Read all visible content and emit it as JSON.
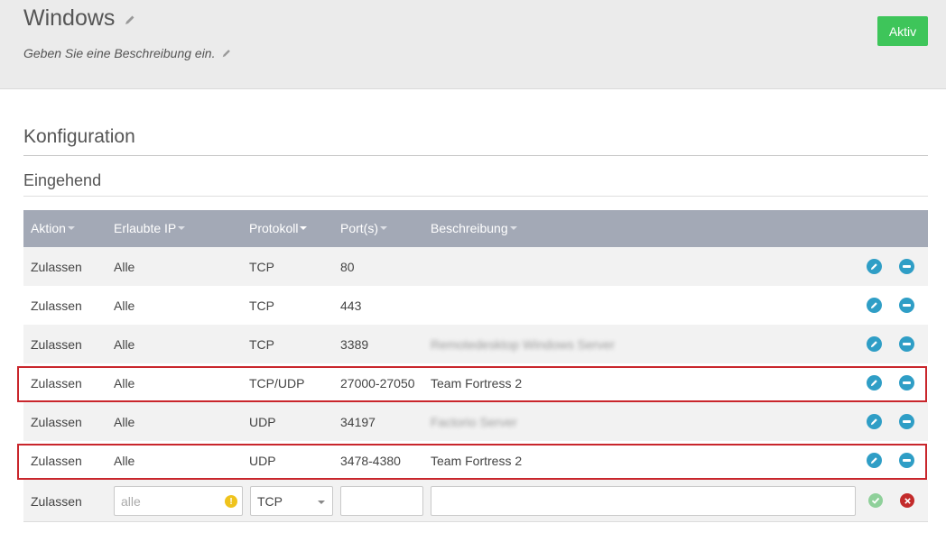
{
  "header": {
    "title": "Windows",
    "description": "Geben Sie eine Beschreibung ein.",
    "status_button": "Aktiv"
  },
  "section": {
    "title": "Konfiguration",
    "subtitle": "Eingehend"
  },
  "table": {
    "columns": [
      "Aktion",
      "Erlaubte IP",
      "Protokoll",
      "Port(s)",
      "Beschreibung"
    ],
    "rows": [
      {
        "action": "Zulassen",
        "ip": "Alle",
        "protocol": "TCP",
        "ports": "80",
        "description": ""
      },
      {
        "action": "Zulassen",
        "ip": "Alle",
        "protocol": "TCP",
        "ports": "443",
        "description": ""
      },
      {
        "action": "Zulassen",
        "ip": "Alle",
        "protocol": "TCP",
        "ports": "3389",
        "description": "Remotedesktop Windows Server"
      },
      {
        "action": "Zulassen",
        "ip": "Alle",
        "protocol": "TCP/UDP",
        "ports": "27000-27050",
        "description": "Team Fortress 2"
      },
      {
        "action": "Zulassen",
        "ip": "Alle",
        "protocol": "UDP",
        "ports": "34197",
        "description": "Factorio Server"
      },
      {
        "action": "Zulassen",
        "ip": "Alle",
        "protocol": "UDP",
        "ports": "3478-4380",
        "description": "Team Fortress 2"
      }
    ],
    "new_row": {
      "action": "Zulassen",
      "ip_placeholder": "alle",
      "protocol": "TCP",
      "ports": "",
      "description": ""
    }
  },
  "colors": {
    "accent_blue": "#2f9ec6",
    "status_green": "#3ec55a",
    "highlight_red": "#c9262c",
    "header_gray": "#a3a9b6"
  },
  "icons": {
    "edit": "pencil-icon",
    "delete": "minus-circle-icon",
    "confirm": "check-circle-icon",
    "cancel": "x-circle-icon",
    "warning": "exclamation-icon"
  }
}
